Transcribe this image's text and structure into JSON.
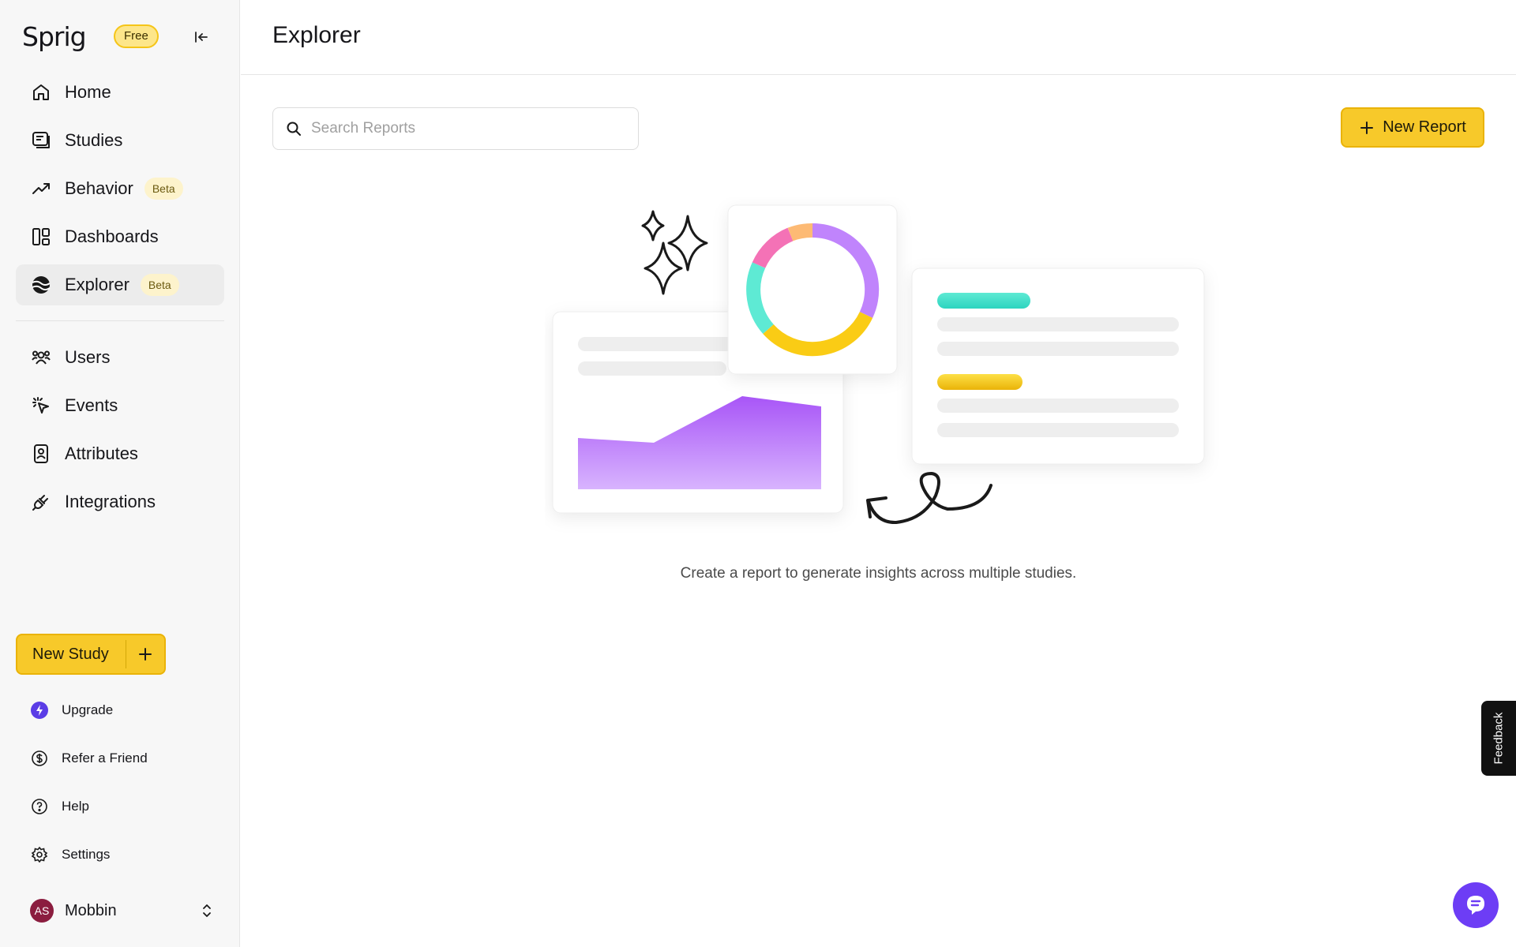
{
  "sidebar": {
    "logo": "Sprig",
    "plan_badge": "Free",
    "nav_items": [
      {
        "label": "Home",
        "icon": "home-icon"
      },
      {
        "label": "Studies",
        "icon": "studies-icon"
      },
      {
        "label": "Behavior",
        "icon": "trending-up-icon",
        "badge": "Beta"
      },
      {
        "label": "Dashboards",
        "icon": "dashboard-icon"
      },
      {
        "label": "Explorer",
        "icon": "explorer-icon",
        "badge": "Beta",
        "active": true
      },
      {
        "label": "Users",
        "icon": "users-icon"
      },
      {
        "label": "Events",
        "icon": "events-icon"
      },
      {
        "label": "Attributes",
        "icon": "attributes-icon"
      },
      {
        "label": "Integrations",
        "icon": "plug-icon"
      }
    ],
    "new_study_label": "New Study",
    "bottom_items": [
      {
        "label": "Upgrade",
        "icon": "bolt-icon"
      },
      {
        "label": "Refer a Friend",
        "icon": "dollar-icon"
      },
      {
        "label": "Help",
        "icon": "help-icon"
      },
      {
        "label": "Settings",
        "icon": "gear-icon"
      }
    ],
    "user": {
      "initials": "AS",
      "name": "Mobbin"
    }
  },
  "header": {
    "title": "Explorer"
  },
  "main": {
    "search_placeholder": "Search Reports",
    "search_value": "",
    "new_report_label": "New Report",
    "empty_caption": "Create a report to generate insights across multiple studies."
  },
  "feedback_label": "Feedback",
  "colors": {
    "accent_yellow": "#f7c92a",
    "chat_purple": "#6d3df5",
    "avatar": "#8b1d3f"
  }
}
